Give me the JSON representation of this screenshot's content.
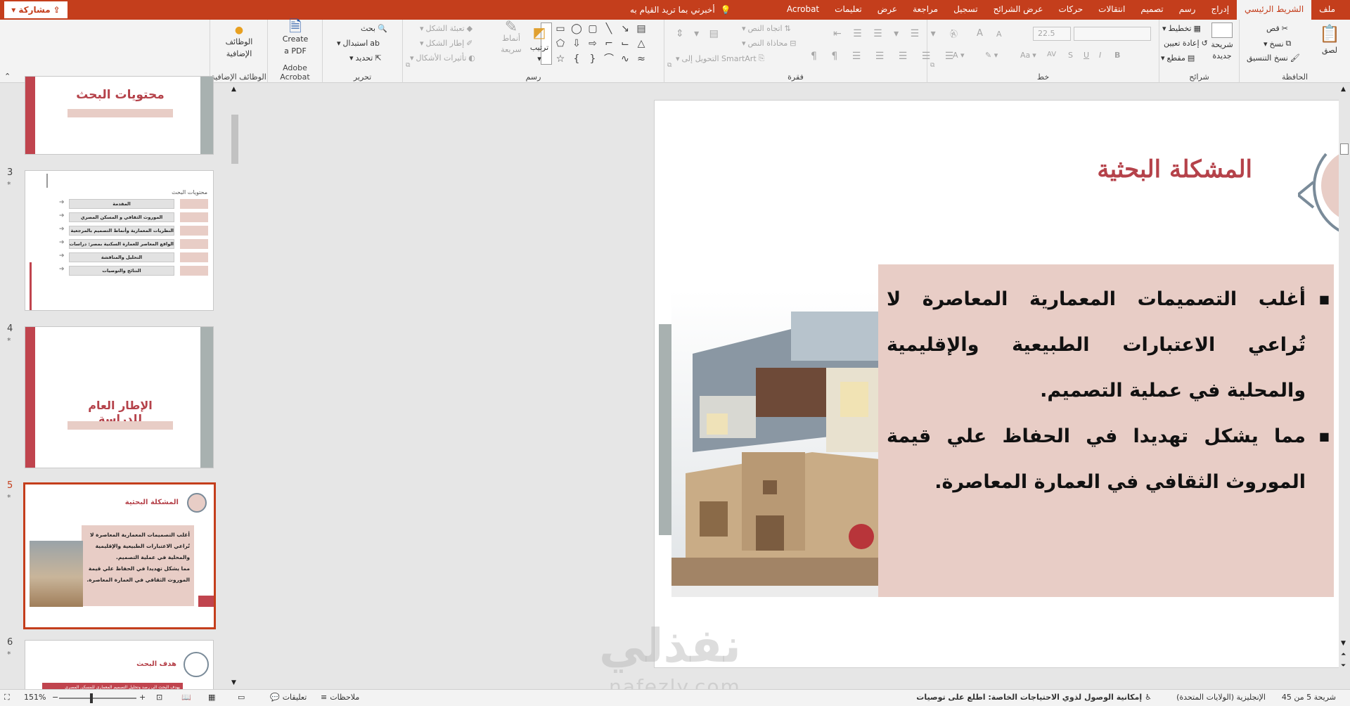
{
  "tabs": [
    "ملف",
    "الشريط الرئيسي",
    "إدراج",
    "رسم",
    "تصميم",
    "انتقالات",
    "حركات",
    "عرض الشرائح",
    "تسجيل",
    "مراجعة",
    "عرض",
    "تعليمات",
    "Acrobat"
  ],
  "active_tab": "الشريط الرئيسي",
  "tellme": "أخبرني بما تريد القيام به",
  "share": "مشاركة",
  "ribbon": {
    "clipboard": {
      "label": "الحافظة",
      "paste": "لصق",
      "cut": "قص",
      "copy": "نسخ",
      "format_painter": "نسخ التنسيق"
    },
    "slides": {
      "label": "شرائح",
      "new_slide_line1": "شريحة",
      "new_slide_line2": "جديدة",
      "layout": "تخطيط",
      "reset": "إعادة تعيين",
      "section": "مقطع"
    },
    "font": {
      "label": "خط",
      "size": "22.5",
      "bold": "B",
      "italic": "I",
      "underline": "U",
      "strike": "S",
      "spacing": "AV",
      "case": "Aa",
      "grow": "A",
      "shrink": "A"
    },
    "paragraph": {
      "label": "فقرة",
      "text_direction": "اتجاه النص",
      "align_text": "محاذاة النص",
      "smartart": "التحويل إلى SmartArt"
    },
    "drawing": {
      "label": "رسم",
      "arrange": "ترتيب",
      "quick_styles_line1": "أنماط",
      "quick_styles_line2": "سريعة",
      "shape_fill": "تعبئة الشكل",
      "shape_outline": "إطار الشكل",
      "shape_effects": "تأثيرات الأشكال"
    },
    "editing": {
      "label": "تحرير",
      "find": "بحث",
      "replace": "استبدال",
      "select": "تحديد"
    },
    "acrobat": {
      "label": "Adobe Acrobat",
      "line1": "Create",
      "line2": "a PDF"
    },
    "addins": {
      "label": "الوظائف الإضافية",
      "line1": "الوظائف",
      "line2": "الإضافية"
    }
  },
  "thumbnails": {
    "slide2_title": "محتويات البحث",
    "slide3": {
      "num": "3",
      "title": "محتويات البحث",
      "rows": [
        "المقدمة",
        "الموروث الثقافي و المسكن المصري",
        "النظريات المعمارية وأنماط التصميم بالمرجعية التراثية",
        "الواقع المعاصر للعمارة السكنية بمصر: دراسات الحالة",
        "التحليل والمناقشة",
        "النتائج والتوصيات"
      ]
    },
    "slide4": {
      "num": "4",
      "title": "الإطار العام للدراسة"
    },
    "slide5": {
      "num": "5",
      "title": "المشكلة البحثية"
    },
    "slide6": {
      "num": "6",
      "title": "هدف البحث",
      "body": "يهدف البحث الى رصد وتحليل التصميم المعماري للمسكن المصري"
    }
  },
  "slide": {
    "title": "المشكلة البحثية",
    "bullets": [
      "أغلب التصميمات المعمارية المعاصرة لا تُراعي الاعتبارات الطبيعية والإقليمية والمحلية في عملية التصميم.",
      "مما يشكل تهديدا في الحفاظ علي قيمة الموروث الثقافي في العمارة المعاصرة."
    ]
  },
  "watermark": {
    "arabic": "نفذلي",
    "latin": "nafezly.com"
  },
  "statusbar": {
    "slide_counter": "شريحة 5 من 45",
    "language": "الإنجليزية (الولايات المتحدة)",
    "accessibility": "إمكانية الوصول لذوي الاحتياجات الخاصة: اطلع على توصيات",
    "notes": "ملاحظات",
    "comments": "تعليقات",
    "zoom": "151%"
  },
  "colors": {
    "accent": "#c43e1c",
    "title_red": "#b5424a",
    "box_pink": "#e8cdc6",
    "deco_red": "#c0444e",
    "gray_bar": "#a8b1b0"
  }
}
